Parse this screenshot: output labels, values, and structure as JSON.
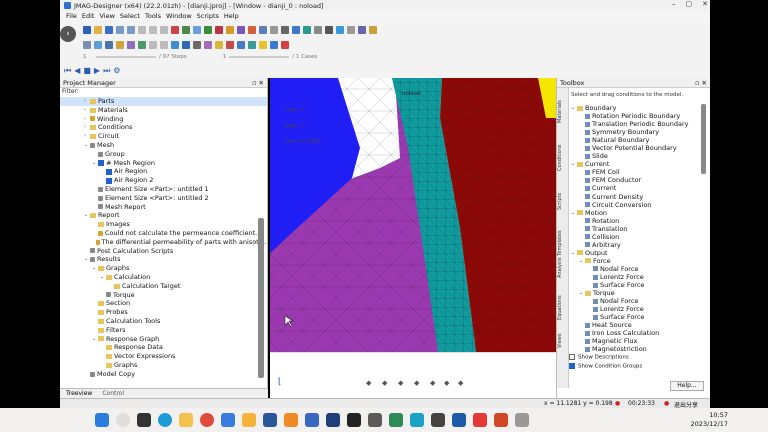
{
  "window": {
    "title": "JMAG-Designer (x64) (22.2.01zh) - [dianji.jproj] - [Window - dianji_0 : noload]",
    "controls": [
      "–",
      "▢",
      "✕"
    ]
  },
  "menu": [
    "File",
    "Edit",
    "View",
    "Select",
    "Tools",
    "Window",
    "Scripts",
    "Help"
  ],
  "steps": {
    "steps_label": "/ 97 Steps",
    "cases_label": "/ 1 Cases",
    "step_value": "1",
    "case_value": "1"
  },
  "project_manager": {
    "title": "Project Manager",
    "filter_label": "Filter:",
    "items": [
      {
        "label": "Parts",
        "indent": 3,
        "icon": "folder",
        "arrow": "›",
        "selected": true
      },
      {
        "label": "Materials",
        "indent": 3,
        "icon": "folder",
        "arrow": "›"
      },
      {
        "label": "Winding",
        "indent": 3,
        "icon": "winding",
        "arrow": "›"
      },
      {
        "label": "Conditions",
        "indent": 3,
        "icon": "folder",
        "arrow": "›"
      },
      {
        "label": "Circuit",
        "indent": 3,
        "icon": "folder",
        "arrow": "›"
      },
      {
        "label": "Mesh",
        "indent": 3,
        "icon": "gear",
        "arrow": "⌄"
      },
      {
        "label": "Group",
        "indent": 4,
        "icon": "gear",
        "arrow": ""
      },
      {
        "label": "# Mesh Region",
        "indent": 4,
        "icon": "check",
        "arrow": "⌄"
      },
      {
        "label": "Air Region",
        "indent": 5,
        "icon": "check",
        "arrow": ""
      },
      {
        "label": "Air Region 2",
        "indent": 5,
        "icon": "check",
        "arrow": ""
      },
      {
        "label": "Element Size <Part>: untitled 1",
        "indent": 4,
        "icon": "gear",
        "arrow": ""
      },
      {
        "label": "Element Size <Part>: untitled 2",
        "indent": 4,
        "icon": "gear",
        "arrow": ""
      },
      {
        "label": "Mesh Report",
        "indent": 4,
        "icon": "gear",
        "arrow": ""
      },
      {
        "label": "Report",
        "indent": 3,
        "icon": "folder",
        "arrow": "⌄"
      },
      {
        "label": "Images",
        "indent": 4,
        "icon": "folder",
        "arrow": ""
      },
      {
        "label": "Could not calculate the permeance coefficient.",
        "indent": 4,
        "icon": "warn",
        "arrow": ""
      },
      {
        "label": "The differential permeability of parts with anisotr...",
        "indent": 4,
        "icon": "warn",
        "arrow": ""
      },
      {
        "label": "Post Calculation Scripts",
        "indent": 3,
        "icon": "gear",
        "arrow": ""
      },
      {
        "label": "Results",
        "indent": 3,
        "icon": "gear",
        "arrow": "⌄"
      },
      {
        "label": "Graphs",
        "indent": 4,
        "icon": "folder",
        "arrow": "⌄"
      },
      {
        "label": "Calculation",
        "indent": 5,
        "icon": "folder",
        "arrow": "⌄"
      },
      {
        "label": "Calculation Target",
        "indent": 6,
        "icon": "folder",
        "arrow": ""
      },
      {
        "label": "Torque",
        "indent": 5,
        "icon": "gear",
        "arrow": ""
      },
      {
        "label": "Section",
        "indent": 4,
        "icon": "folder",
        "arrow": ""
      },
      {
        "label": "Probes",
        "indent": 4,
        "icon": "folder",
        "arrow": ""
      },
      {
        "label": "Calculation Tools",
        "indent": 4,
        "icon": "folder",
        "arrow": ""
      },
      {
        "label": "Filters",
        "indent": 4,
        "icon": "folder",
        "arrow": ""
      },
      {
        "label": "Response Graph",
        "indent": 4,
        "icon": "folder",
        "arrow": "⌄"
      },
      {
        "label": "Response Data",
        "indent": 5,
        "icon": "folder",
        "arrow": ""
      },
      {
        "label": "Vector Expressions",
        "indent": 5,
        "icon": "folder",
        "arrow": ""
      },
      {
        "label": "Graphs",
        "indent": 5,
        "icon": "folder",
        "arrow": ""
      },
      {
        "label": "Model Copy",
        "indent": 3,
        "icon": "gear",
        "arrow": ""
      }
    ],
    "tabs": [
      "Treeview",
      "Control"
    ]
  },
  "viewport": {
    "labels": [
      "noload",
      "Case: 1",
      "Step: 1",
      "Time: 0.0000"
    ],
    "colors": {
      "blue": "#1f1ff5",
      "magenta": "#9b3ab0",
      "teal": "#109b9e",
      "darkred": "#8b0a08",
      "yellow": "#f5e600"
    }
  },
  "toolbox": {
    "title": "Toolbox",
    "hint": "Select and drag conditions to the model.",
    "side_tabs": [
      "Materials",
      "Conditions",
      "Scripts",
      "Analysis Templates",
      "Equations",
      "Views"
    ],
    "items": [
      {
        "label": "Boundary",
        "indent": 0,
        "arrow": "⌄",
        "folder": true
      },
      {
        "label": "Rotation Periodic Boundary",
        "indent": 1
      },
      {
        "label": "Translation Periodic Boundary",
        "indent": 1
      },
      {
        "label": "Symmetry Boundary",
        "indent": 1
      },
      {
        "label": "Natural Boundary",
        "indent": 1
      },
      {
        "label": "Vector Potential Boundary",
        "indent": 1
      },
      {
        "label": "Slide",
        "indent": 1
      },
      {
        "label": "Current",
        "indent": 0,
        "arrow": "⌄",
        "folder": true
      },
      {
        "label": "FEM Coil",
        "indent": 1
      },
      {
        "label": "FEM Conductor",
        "indent": 1
      },
      {
        "label": "Current",
        "indent": 1
      },
      {
        "label": "Current Density",
        "indent": 1
      },
      {
        "label": "Circuit Conversion",
        "indent": 1
      },
      {
        "label": "Motion",
        "indent": 0,
        "arrow": "⌄",
        "folder": true
      },
      {
        "label": "Rotation",
        "indent": 1
      },
      {
        "label": "Translation",
        "indent": 1
      },
      {
        "label": "Collision",
        "indent": 1
      },
      {
        "label": "Arbitrary",
        "indent": 1
      },
      {
        "label": "Output",
        "indent": 0,
        "arrow": "⌄",
        "folder": true
      },
      {
        "label": "Force",
        "indent": 1,
        "arrow": "⌄",
        "folder": true
      },
      {
        "label": "Nodal Force",
        "indent": 2
      },
      {
        "label": "Lorentz Force",
        "indent": 2
      },
      {
        "label": "Surface Force",
        "indent": 2
      },
      {
        "label": "Torque",
        "indent": 1,
        "arrow": "⌄",
        "folder": true
      },
      {
        "label": "Nodal Force",
        "indent": 2
      },
      {
        "label": "Lorentz Force",
        "indent": 2
      },
      {
        "label": "Surface Force",
        "indent": 2
      },
      {
        "label": "Heat Source",
        "indent": 1
      },
      {
        "label": "Iron Loss Calculation",
        "indent": 1
      },
      {
        "label": "Magnetic Flux",
        "indent": 1
      },
      {
        "label": "Magnetostriction",
        "indent": 1
      }
    ],
    "show_descriptions": "Show Descriptions",
    "show_condition_groups": "Show Condition Groups",
    "help_button": "Help..."
  },
  "status": {
    "coords": "x = 11.1281  y = 0.198",
    "recording_time": "00:23:33",
    "exit_share": "退出分享"
  },
  "taskbar": {
    "time": "10:57",
    "date": "2023/12/17",
    "apps": [
      "windows",
      "search",
      "taskview",
      "edge",
      "explorer",
      "chrome",
      "store",
      "mail",
      "word",
      "pdf",
      "excel",
      "app1",
      "app2",
      "app3",
      "app4",
      "app5",
      "app6",
      "app7",
      "app8",
      "youdao",
      "powerpoint",
      "app9"
    ]
  }
}
